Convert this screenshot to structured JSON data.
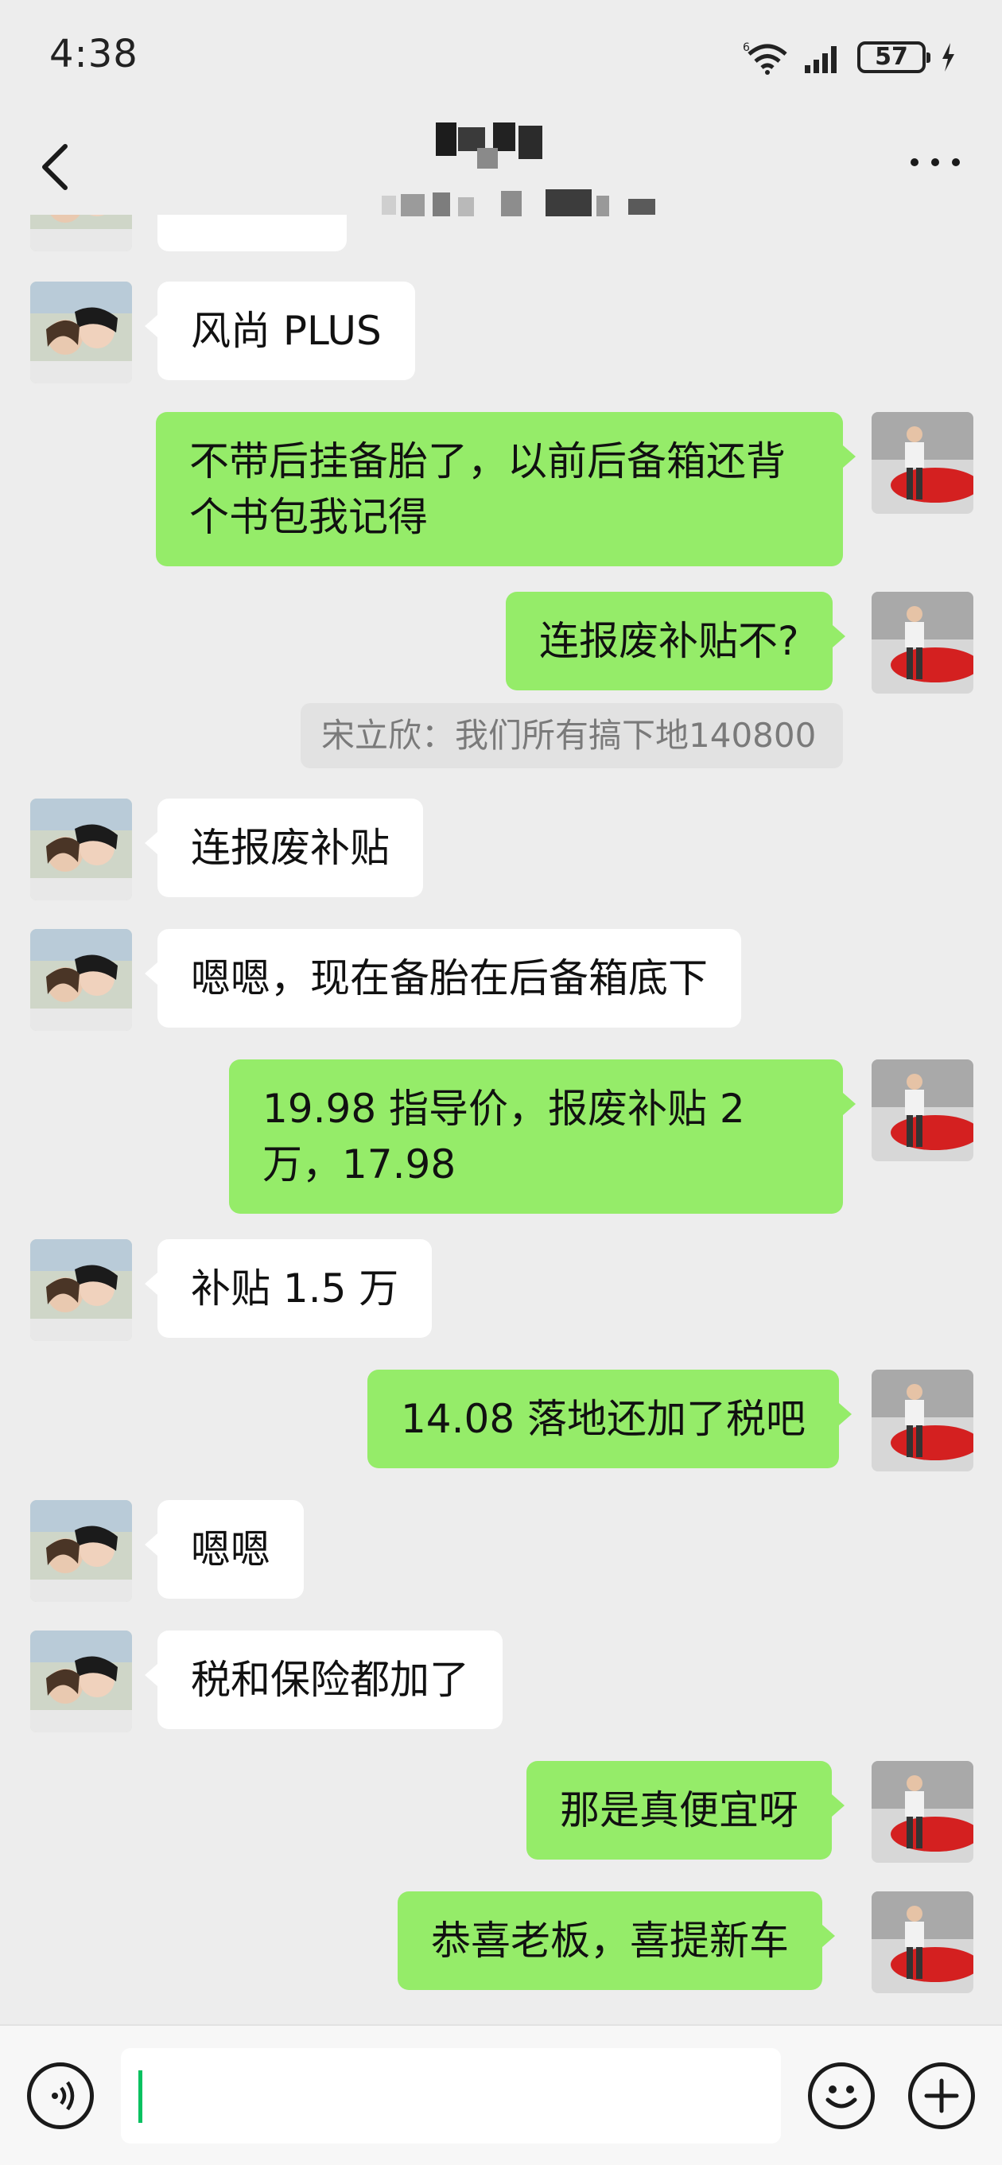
{
  "status_bar": {
    "time": "4:38",
    "battery": "57"
  },
  "header": {
    "title": ""
  },
  "messages": [
    {
      "side": "left",
      "text": "风尚 PLUS"
    },
    {
      "side": "right",
      "text": "不带后挂备胎了，以前后备箱还背个书包我记得"
    },
    {
      "side": "right",
      "text": "连报废补贴不?"
    },
    {
      "side": "quote",
      "text": "宋立欣：我们所有搞下地140800"
    },
    {
      "side": "left",
      "text": "连报废补贴"
    },
    {
      "side": "left",
      "text": "嗯嗯，现在备胎在后备箱底下"
    },
    {
      "side": "right",
      "text": "19.98 指导价，报废补贴 2 万，17.98"
    },
    {
      "side": "left",
      "text": "补贴 1.5 万"
    },
    {
      "side": "right",
      "text": "14.08 落地还加了税吧"
    },
    {
      "side": "left",
      "text": "嗯嗯"
    },
    {
      "side": "left",
      "text": "税和保险都加了"
    },
    {
      "side": "right",
      "text": "那是真便宜呀"
    },
    {
      "side": "right",
      "text": "恭喜老板，喜提新车"
    }
  ],
  "icons": {
    "back": "chevron-left-icon",
    "more": "more-dots-icon",
    "voice": "voice-icon",
    "emoji": "emoji-icon",
    "add": "plus-icon"
  },
  "colors": {
    "background": "#ededed",
    "sent_bubble": "#95ec69",
    "received_bubble": "#ffffff",
    "cursor": "#07c160"
  }
}
